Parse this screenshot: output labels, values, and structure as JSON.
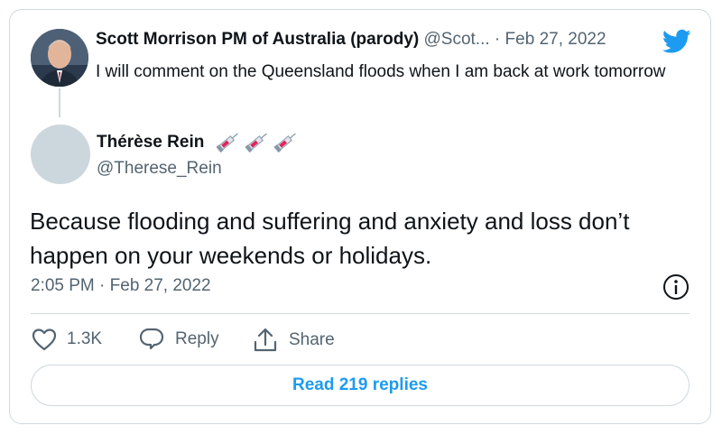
{
  "quoted_tweet": {
    "author_name": "Scott Morrison PM of Australia (parody)",
    "author_handle": "@Scot...",
    "separator": " · ",
    "date": "Feb 27, 2022",
    "text": "I will comment on the Queensland floods when I am back at work tomorrow"
  },
  "tweet": {
    "author_name": "Thérèse Rein",
    "author_handle": "@Therese_Rein",
    "name_emoji": [
      "syringe-icon",
      "syringe-icon",
      "syringe-icon"
    ],
    "text": "Because flooding and suffering and anxiety and loss don’t happen on your weekends or holidays.",
    "timestamp": "2:05 PM · Feb 27, 2022"
  },
  "actions": {
    "like_count": "1.3K",
    "reply_label": "Reply",
    "share_label": "Share"
  },
  "read_replies_label": "Read 219 replies",
  "colors": {
    "brand_blue": "#1d9bf0",
    "text_primary": "#0f1419",
    "text_secondary": "#536471",
    "border": "#cfd9de"
  }
}
